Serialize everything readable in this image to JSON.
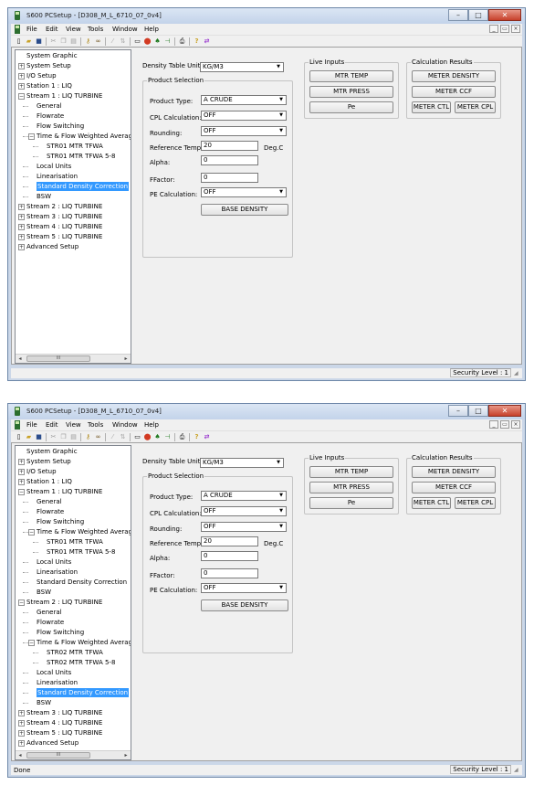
{
  "colors": {
    "titlebar": "#c3d3ea",
    "selection": "#3399ff",
    "close_button": "#c7402b",
    "client_bg": "#f0f0f0"
  },
  "title": "S600 PCSetup - [D308_M_L_6710_07_0v4]",
  "menus": [
    "File",
    "Edit",
    "View",
    "Tools",
    "Window",
    "Help"
  ],
  "window_controls": {
    "minimize": "–",
    "maximize": "□",
    "close": "✕"
  },
  "mdi_controls": {
    "minimize": "_",
    "restore": "▭",
    "close": "×"
  },
  "toolbar_icons": [
    "new-file-icon",
    "open-folder-icon",
    "save-icon",
    "cut-icon",
    "copy-icon",
    "paste-icon",
    "key-icon",
    "binoculars-icon",
    "wand-icon",
    "compare-icon",
    "rectangle-icon",
    "stop-icon",
    "connect-icon",
    "transfer-icon",
    "print-icon",
    "help-icon",
    "swap-icon"
  ],
  "density_units": {
    "label": "Density Table Units",
    "value": "KG/M3"
  },
  "product_selection": {
    "title": "Product Selection",
    "product_type": {
      "label": "Product Type:",
      "value": "A CRUDE"
    },
    "cpl_calc": {
      "label": "CPL Calculation:",
      "value": "OFF"
    },
    "rounding": {
      "label": "Rounding:",
      "value": "OFF"
    },
    "ref_temp": {
      "label": "Reference Temp:",
      "value": "20",
      "unit": "Deg.C"
    },
    "alpha": {
      "label": "Alpha:",
      "value": "0"
    },
    "ffactor": {
      "label": "FFactor:",
      "value": "0"
    },
    "pe_calc": {
      "label": "PE Calculation:",
      "value": "OFF"
    },
    "base_density": "BASE DENSITY"
  },
  "live_inputs": {
    "title": "Live Inputs",
    "buttons": [
      "MTR TEMP",
      "MTR PRESS",
      "Pe"
    ]
  },
  "calc_results": {
    "title": "Calculation Results",
    "meter_density": "METER DENSITY",
    "meter_ccf": "METER CCF",
    "meter_ctl": "METER CTL",
    "meter_cpl": "METER CPL"
  },
  "scrollbar_thumb": "III",
  "scroll_arrows": {
    "left": "◂",
    "right": "▸"
  },
  "tree_top": [
    {
      "label": "System Graphic",
      "depth": 0,
      "exp": ""
    },
    {
      "label": "System Setup",
      "depth": 0,
      "exp": "+"
    },
    {
      "label": "I/O Setup",
      "depth": 0,
      "exp": "+"
    },
    {
      "label": "Station 1 : LIQ",
      "depth": 0,
      "exp": "+"
    },
    {
      "label": "Stream 1 : LIQ TURBINE",
      "depth": 0,
      "exp": "−"
    },
    {
      "label": "General",
      "depth": 1,
      "exp": ""
    },
    {
      "label": "Flowrate",
      "depth": 1,
      "exp": ""
    },
    {
      "label": "Flow Switching",
      "depth": 1,
      "exp": ""
    },
    {
      "label": "Time & Flow Weighted Averag",
      "depth": 1,
      "exp": "−"
    },
    {
      "label": "STR01 MTR TFWA",
      "depth": 2,
      "exp": ""
    },
    {
      "label": "STR01 MTR TFWA 5-8",
      "depth": 2,
      "exp": ""
    },
    {
      "label": "Local Units",
      "depth": 1,
      "exp": ""
    },
    {
      "label": "Linearisation",
      "depth": 1,
      "exp": ""
    },
    {
      "label": "Standard Density Correction",
      "depth": 1,
      "exp": "",
      "selected": true
    },
    {
      "label": "BSW",
      "depth": 1,
      "exp": ""
    },
    {
      "label": "Stream 2 : LIQ TURBINE",
      "depth": 0,
      "exp": "+"
    },
    {
      "label": "Stream 3 : LIQ TURBINE",
      "depth": 0,
      "exp": "+"
    },
    {
      "label": "Stream 4 : LIQ TURBINE",
      "depth": 0,
      "exp": "+"
    },
    {
      "label": "Stream 5 : LIQ TURBINE",
      "depth": 0,
      "exp": "+"
    },
    {
      "label": "Advanced Setup",
      "depth": 0,
      "exp": "+"
    }
  ],
  "tree_bottom": [
    {
      "label": "System Graphic",
      "depth": 0,
      "exp": ""
    },
    {
      "label": "System Setup",
      "depth": 0,
      "exp": "+"
    },
    {
      "label": "I/O Setup",
      "depth": 0,
      "exp": "+"
    },
    {
      "label": "Station 1 : LIQ",
      "depth": 0,
      "exp": "+"
    },
    {
      "label": "Stream 1 : LIQ TURBINE",
      "depth": 0,
      "exp": "−"
    },
    {
      "label": "General",
      "depth": 1,
      "exp": ""
    },
    {
      "label": "Flowrate",
      "depth": 1,
      "exp": ""
    },
    {
      "label": "Flow Switching",
      "depth": 1,
      "exp": ""
    },
    {
      "label": "Time & Flow Weighted Averag",
      "depth": 1,
      "exp": "−"
    },
    {
      "label": "STR01 MTR TFWA",
      "depth": 2,
      "exp": ""
    },
    {
      "label": "STR01 MTR TFWA 5-8",
      "depth": 2,
      "exp": ""
    },
    {
      "label": "Local Units",
      "depth": 1,
      "exp": ""
    },
    {
      "label": "Linearisation",
      "depth": 1,
      "exp": ""
    },
    {
      "label": "Standard Density Correction",
      "depth": 1,
      "exp": ""
    },
    {
      "label": "BSW",
      "depth": 1,
      "exp": ""
    },
    {
      "label": "Stream 2 : LIQ TURBINE",
      "depth": 0,
      "exp": "−"
    },
    {
      "label": "General",
      "depth": 1,
      "exp": ""
    },
    {
      "label": "Flowrate",
      "depth": 1,
      "exp": ""
    },
    {
      "label": "Flow Switching",
      "depth": 1,
      "exp": ""
    },
    {
      "label": "Time & Flow Weighted Averag",
      "depth": 1,
      "exp": "−"
    },
    {
      "label": "STR02 MTR TFWA",
      "depth": 2,
      "exp": ""
    },
    {
      "label": "STR02 MTR TFWA 5-8",
      "depth": 2,
      "exp": ""
    },
    {
      "label": "Local Units",
      "depth": 1,
      "exp": ""
    },
    {
      "label": "Linearisation",
      "depth": 1,
      "exp": ""
    },
    {
      "label": "Standard Density Correction",
      "depth": 1,
      "exp": "",
      "selected": true
    },
    {
      "label": "BSW",
      "depth": 1,
      "exp": ""
    },
    {
      "label": "Stream 3 : LIQ TURBINE",
      "depth": 0,
      "exp": "+"
    },
    {
      "label": "Stream 4 : LIQ TURBINE",
      "depth": 0,
      "exp": "+"
    },
    {
      "label": "Stream 5 : LIQ TURBINE",
      "depth": 0,
      "exp": "+"
    },
    {
      "label": "Advanced Setup",
      "depth": 0,
      "exp": "+"
    }
  ],
  "status_top": {
    "left": "",
    "right": "Security Level : 1"
  },
  "status_bottom": {
    "left": "Done",
    "right": "Security Level : 1"
  }
}
